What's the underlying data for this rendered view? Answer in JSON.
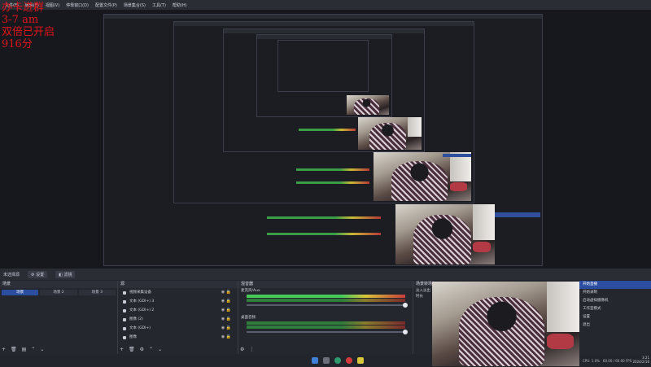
{
  "menubar": {
    "items": [
      "文件(F)",
      "编辑(E)",
      "视图(V)",
      "停靠窗口(D)",
      "配置文件(P)",
      "场景集合(S)",
      "工具(T)",
      "帮助(H)"
    ]
  },
  "overlay": {
    "lines": [
      "办卡进群",
      "3-7 am",
      "双倍已开启",
      "916分"
    ],
    "color": "#e0131a"
  },
  "control_bar": {
    "status": "未选择源",
    "settings_label": "设置",
    "filters_label": "滤镜"
  },
  "scenes": {
    "title": "场景",
    "tabs": [
      {
        "label": "场景",
        "active": true
      },
      {
        "label": "场景 2",
        "active": false
      },
      {
        "label": "场景 3",
        "active": false
      }
    ]
  },
  "sources": {
    "title": "源",
    "items": [
      {
        "label": "视频采集设备"
      },
      {
        "label": "文本 (GDI+) 3"
      },
      {
        "label": "文本 (GDI+) 2"
      },
      {
        "label": "图像 (2)"
      },
      {
        "label": "文本 (GDI+)"
      },
      {
        "label": "图像"
      }
    ]
  },
  "mixer": {
    "title": "混音器",
    "tracks": [
      {
        "name": "麦克风/Aux",
        "level": 0.62
      },
      {
        "name": "桌面音频",
        "level": 0.0
      }
    ]
  },
  "transitions": {
    "title": "场景转场",
    "mode": "淡入淡出",
    "duration_label": "时长"
  },
  "controls": {
    "items": [
      {
        "label": "开始直播",
        "active": true
      },
      {
        "label": "开始录制",
        "active": false
      },
      {
        "label": "启动虚拟摄像机",
        "active": false
      },
      {
        "label": "工作室模式",
        "active": false
      },
      {
        "label": "设置",
        "active": false
      },
      {
        "label": "退出",
        "active": false
      }
    ]
  },
  "status": {
    "cpu": "CPU: 1.0%",
    "fps": "60.00 / 60.00 FPS"
  },
  "tray": {
    "time": "3:21",
    "date": "2024/2/16"
  },
  "colors": {
    "accent": "#2b4ea1",
    "overlay_text": "#e0131a",
    "background": "#1e1f26"
  }
}
